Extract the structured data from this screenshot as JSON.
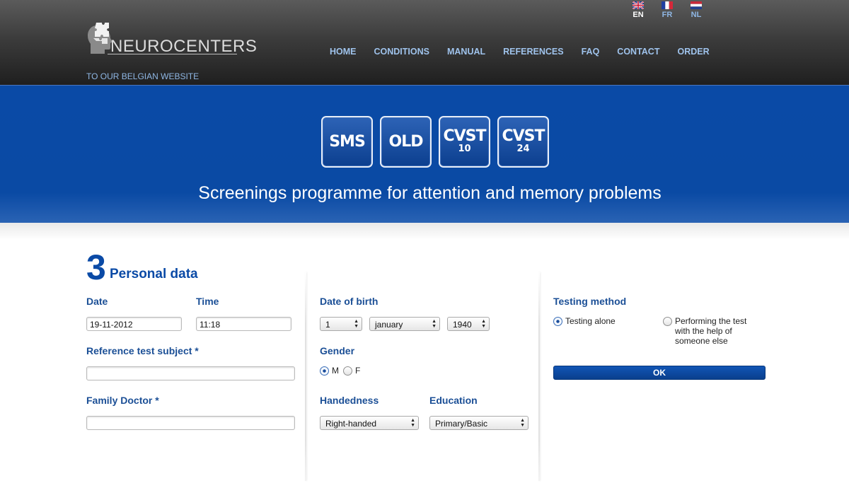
{
  "header": {
    "logo_text": "NEUROCENTERS",
    "belgian_link": "TO OUR BELGIAN WEBSITE",
    "languages": [
      {
        "code": "EN",
        "active": true
      },
      {
        "code": "FR",
        "active": false
      },
      {
        "code": "NL",
        "active": false
      }
    ],
    "nav": [
      "HOME",
      "CONDITIONS",
      "MANUAL",
      "REFERENCES",
      "FAQ",
      "CONTACT",
      "ORDER"
    ]
  },
  "banner": {
    "tiles": [
      {
        "line1": "SMS",
        "line2": ""
      },
      {
        "line1": "OLD",
        "line2": ""
      },
      {
        "line1": "CVST",
        "line2": "10"
      },
      {
        "line1": "CVST",
        "line2": "24"
      }
    ],
    "title": "Screenings programme for attention and memory problems"
  },
  "form": {
    "step_number": "3",
    "step_title": "Personal data",
    "date_label": "Date",
    "date_value": "19-11-2012",
    "time_label": "Time",
    "time_value": "11:18",
    "reference_label": "Reference test subject *",
    "reference_value": "",
    "doctor_label": "Family Doctor *",
    "doctor_value": "",
    "dob_label": "Date of birth",
    "dob_day": "1",
    "dob_month": "january",
    "dob_year": "1940",
    "gender_label": "Gender",
    "gender_m": "M",
    "gender_f": "F",
    "gender_selected": "M",
    "handedness_label": "Handedness",
    "handedness_value": "Right-handed",
    "education_label": "Education",
    "education_value": "Primary/Basic",
    "testing_label": "Testing method",
    "testing_alone": "Testing alone",
    "testing_help": "Performing the test with the help of someone else",
    "testing_selected": "alone",
    "ok_label": "OK"
  },
  "colors": {
    "brand_blue": "#0a4aa6",
    "label_blue": "#1b4f96",
    "nav_text": "#9fc3ec"
  }
}
